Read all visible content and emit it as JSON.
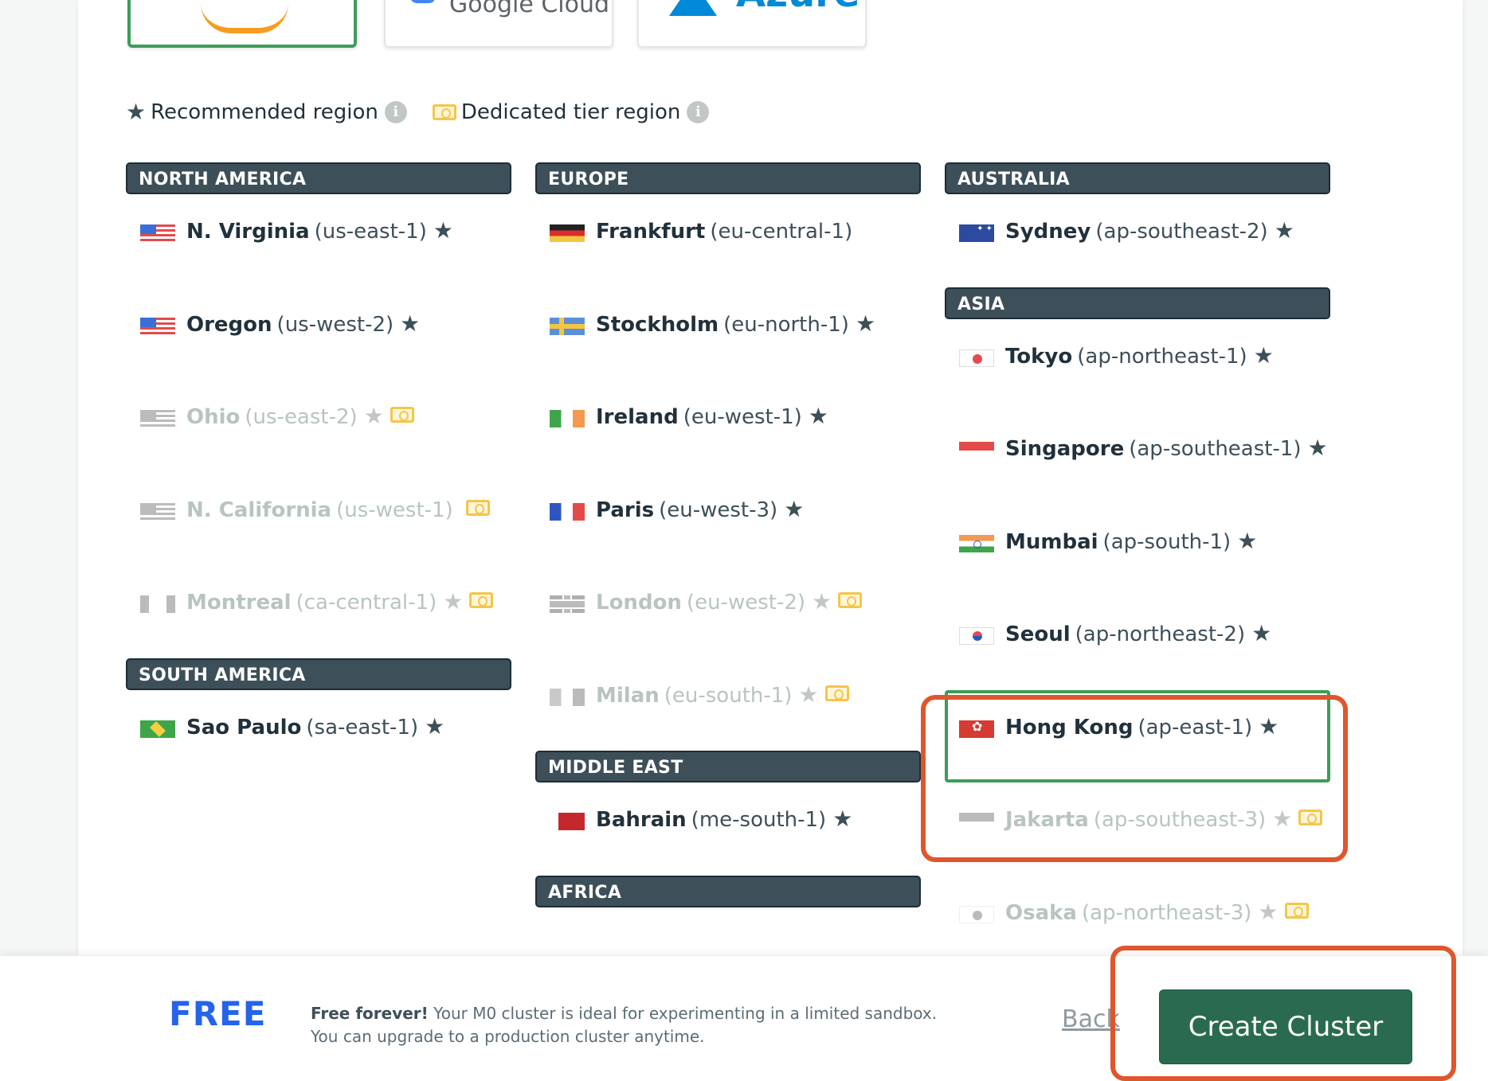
{
  "providers": [
    {
      "id": "aws",
      "label": "aws",
      "selected": true
    },
    {
      "id": "gcp",
      "label": "Google Cloud",
      "selected": false
    },
    {
      "id": "azure",
      "label": "Azure",
      "selected": false
    }
  ],
  "legend": {
    "recommended": "Recommended region",
    "dedicated": "Dedicated tier region"
  },
  "columns": [
    {
      "sections": [
        {
          "title": "NORTH AMERICA",
          "regions": [
            {
              "name": "N. Virginia",
              "code": "(us-east-1)",
              "flag": "us",
              "star": true,
              "dedicated": false,
              "disabled": false
            },
            {
              "name": "Oregon",
              "code": "(us-west-2)",
              "flag": "us",
              "star": true,
              "dedicated": false,
              "disabled": false
            },
            {
              "name": "Ohio",
              "code": "(us-east-2)",
              "flag": "us",
              "star": true,
              "dedicated": true,
              "disabled": true
            },
            {
              "name": "N. California",
              "code": "(us-west-1)",
              "flag": "us",
              "star": false,
              "dedicated": true,
              "disabled": true
            },
            {
              "name": "Montreal",
              "code": "(ca-central-1)",
              "flag": "ca",
              "star": true,
              "dedicated": true,
              "disabled": true
            }
          ]
        },
        {
          "title": "SOUTH AMERICA",
          "regions": [
            {
              "name": "Sao Paulo",
              "code": "(sa-east-1)",
              "flag": "br",
              "star": true,
              "dedicated": false,
              "disabled": false
            }
          ]
        }
      ]
    },
    {
      "sections": [
        {
          "title": "EUROPE",
          "regions": [
            {
              "name": "Frankfurt",
              "code": "(eu-central-1)",
              "flag": "de",
              "star": false,
              "dedicated": false,
              "disabled": false
            },
            {
              "name": "Stockholm",
              "code": "(eu-north-1)",
              "flag": "se",
              "star": true,
              "dedicated": false,
              "disabled": false
            },
            {
              "name": "Ireland",
              "code": "(eu-west-1)",
              "flag": "ie",
              "star": true,
              "dedicated": false,
              "disabled": false
            },
            {
              "name": "Paris",
              "code": "(eu-west-3)",
              "flag": "fr",
              "star": true,
              "dedicated": false,
              "disabled": false
            },
            {
              "name": "London",
              "code": "(eu-west-2)",
              "flag": "uk",
              "star": true,
              "dedicated": true,
              "disabled": true
            },
            {
              "name": "Milan",
              "code": "(eu-south-1)",
              "flag": "it",
              "star": true,
              "dedicated": true,
              "disabled": true
            }
          ]
        },
        {
          "title": "MIDDLE EAST",
          "regions": [
            {
              "name": "Bahrain",
              "code": "(me-south-1)",
              "flag": "bh",
              "star": true,
              "dedicated": false,
              "disabled": false
            }
          ]
        },
        {
          "title": "AFRICA",
          "regions": []
        }
      ]
    },
    {
      "sections": [
        {
          "title": "AUSTRALIA",
          "regions": [
            {
              "name": "Sydney",
              "code": "(ap-southeast-2)",
              "flag": "au",
              "star": true,
              "dedicated": false,
              "disabled": false
            }
          ]
        },
        {
          "title": "ASIA",
          "regions": [
            {
              "name": "Tokyo",
              "code": "(ap-northeast-1)",
              "flag": "jp",
              "star": true,
              "dedicated": false,
              "disabled": false
            },
            {
              "name": "Singapore",
              "code": "(ap-southeast-1)",
              "flag": "sg",
              "star": true,
              "dedicated": false,
              "disabled": false
            },
            {
              "name": "Mumbai",
              "code": "(ap-south-1)",
              "flag": "in",
              "star": true,
              "dedicated": false,
              "disabled": false
            },
            {
              "name": "Seoul",
              "code": "(ap-northeast-2)",
              "flag": "kr",
              "star": true,
              "dedicated": false,
              "disabled": false
            },
            {
              "name": "Hong Kong",
              "code": "(ap-east-1)",
              "flag": "hk",
              "star": true,
              "dedicated": false,
              "disabled": false,
              "selected": true
            },
            {
              "name": "Jakarta",
              "code": "(ap-southeast-3)",
              "flag": "id",
              "star": true,
              "dedicated": true,
              "disabled": true
            },
            {
              "name": "Osaka",
              "code": "(ap-northeast-3)",
              "flag": "jp",
              "star": true,
              "dedicated": true,
              "disabled": true
            }
          ]
        }
      ]
    }
  ],
  "footer": {
    "tier": "FREE",
    "desc_bold": "Free forever!",
    "desc_text": " Your M0 cluster is ideal for experimenting in a limited sandbox. You can upgrade to a production cluster anytime.",
    "back": "Back",
    "create": "Create Cluster"
  },
  "colors": {
    "selected": "#3d9c5a",
    "highlight": "#e0562c",
    "primary_button": "#2a6b4f",
    "tier": "#2563eb"
  }
}
